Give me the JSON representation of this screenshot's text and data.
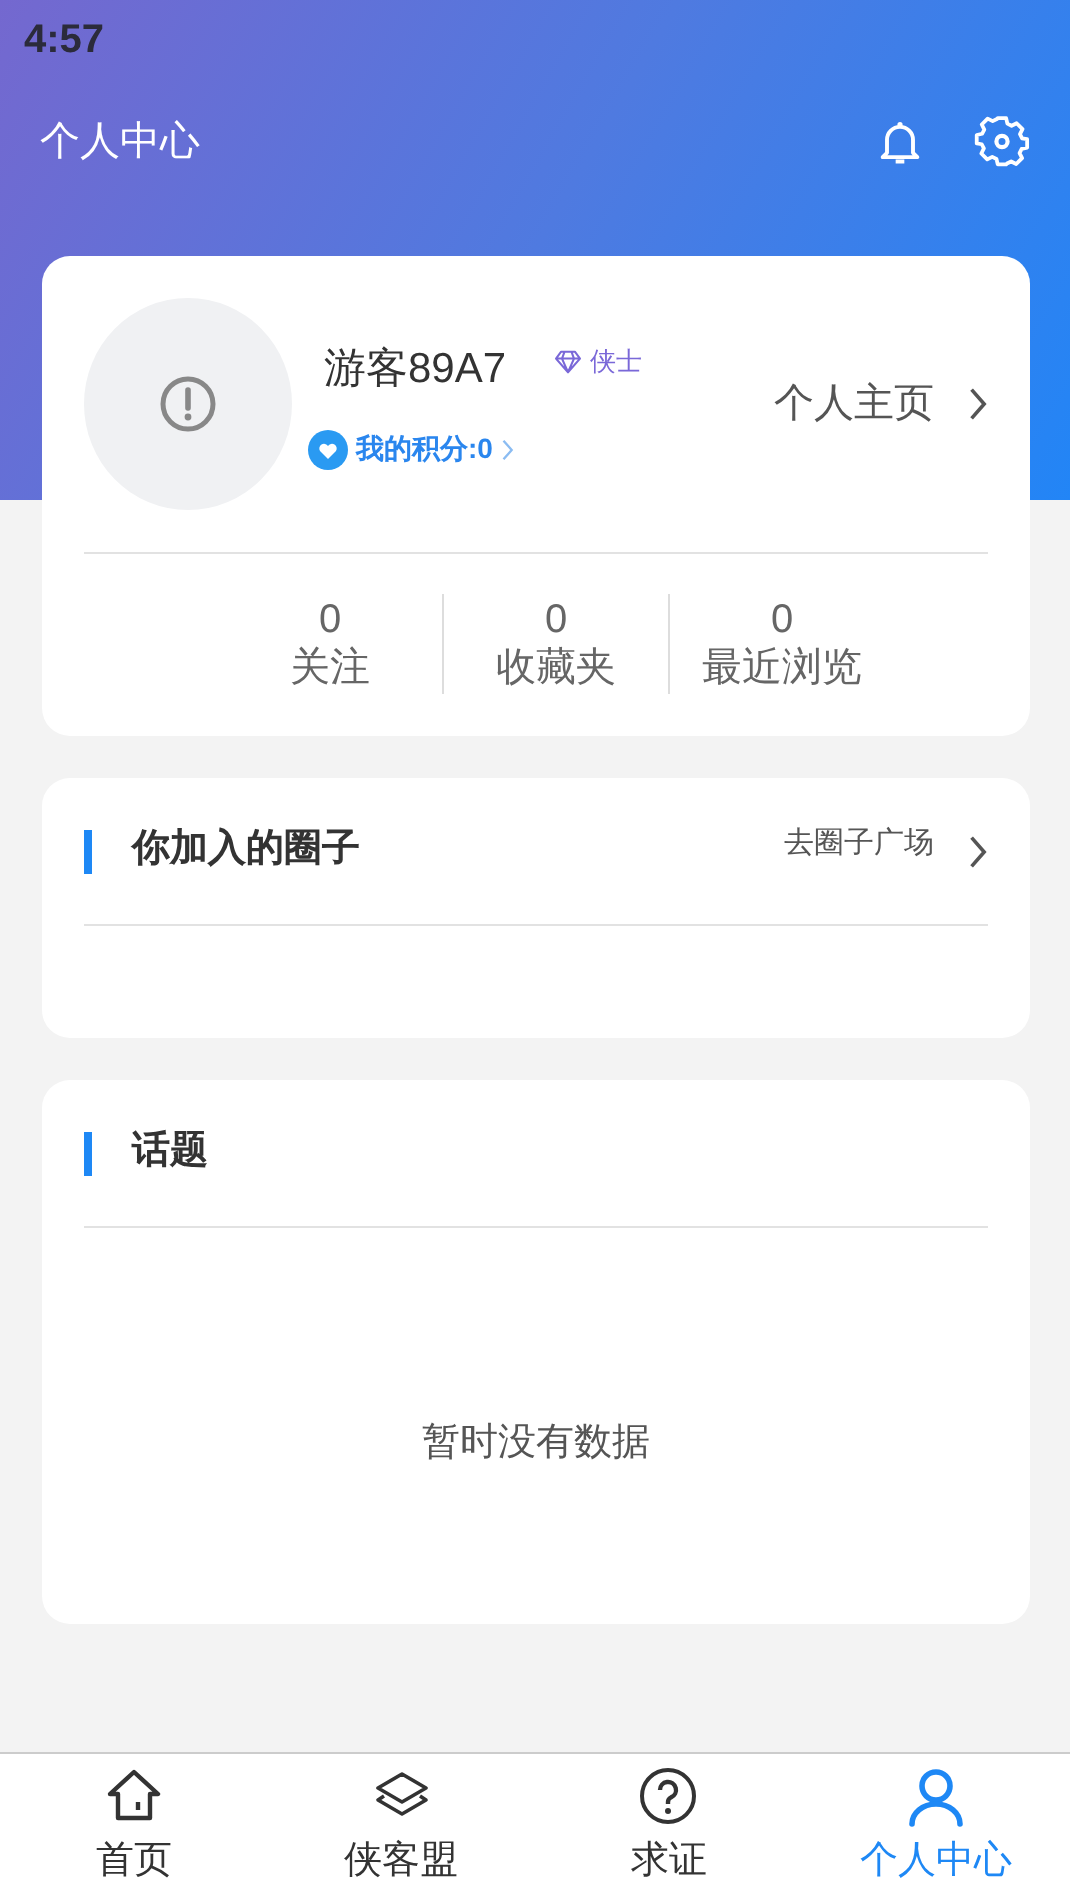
{
  "status_bar": {
    "time": "4:57"
  },
  "header": {
    "title": "个人中心"
  },
  "profile": {
    "name": "游客89A7",
    "rank": "侠士",
    "points": "我的积分:0",
    "homepage": "个人主页"
  },
  "stats": [
    {
      "value": "0",
      "label": "关注"
    },
    {
      "value": "0",
      "label": "收藏夹"
    },
    {
      "value": "0",
      "label": "最近浏览"
    }
  ],
  "circles": {
    "title": "你加入的圈子",
    "link": "去圈子广场"
  },
  "topics": {
    "title": "话题",
    "empty": "暂时没有数据"
  },
  "tabs": [
    {
      "label": "首页",
      "selected": false
    },
    {
      "label": "侠客盟",
      "selected": false
    },
    {
      "label": "求证",
      "selected": false
    },
    {
      "label": "个人中心",
      "selected": true
    }
  ]
}
